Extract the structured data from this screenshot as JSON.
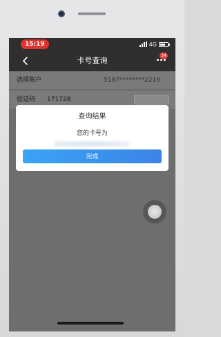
{
  "status_bar": {
    "time": "15:19",
    "network": "4G"
  },
  "nav": {
    "title": "卡号查询",
    "badge_count": "34"
  },
  "form": {
    "account_label": "选择账户",
    "account_value": "5187********2216",
    "code_label": "验证码",
    "code_value": "171728"
  },
  "dialog": {
    "title": "查询结果",
    "message": "您的卡号为",
    "button_label": "完成"
  },
  "colors": {
    "time_pill": "#e0322f",
    "button_gradient_start": "#3aa4f5",
    "button_gradient_end": "#3c83e6",
    "overlay": "#6e6e6e"
  }
}
